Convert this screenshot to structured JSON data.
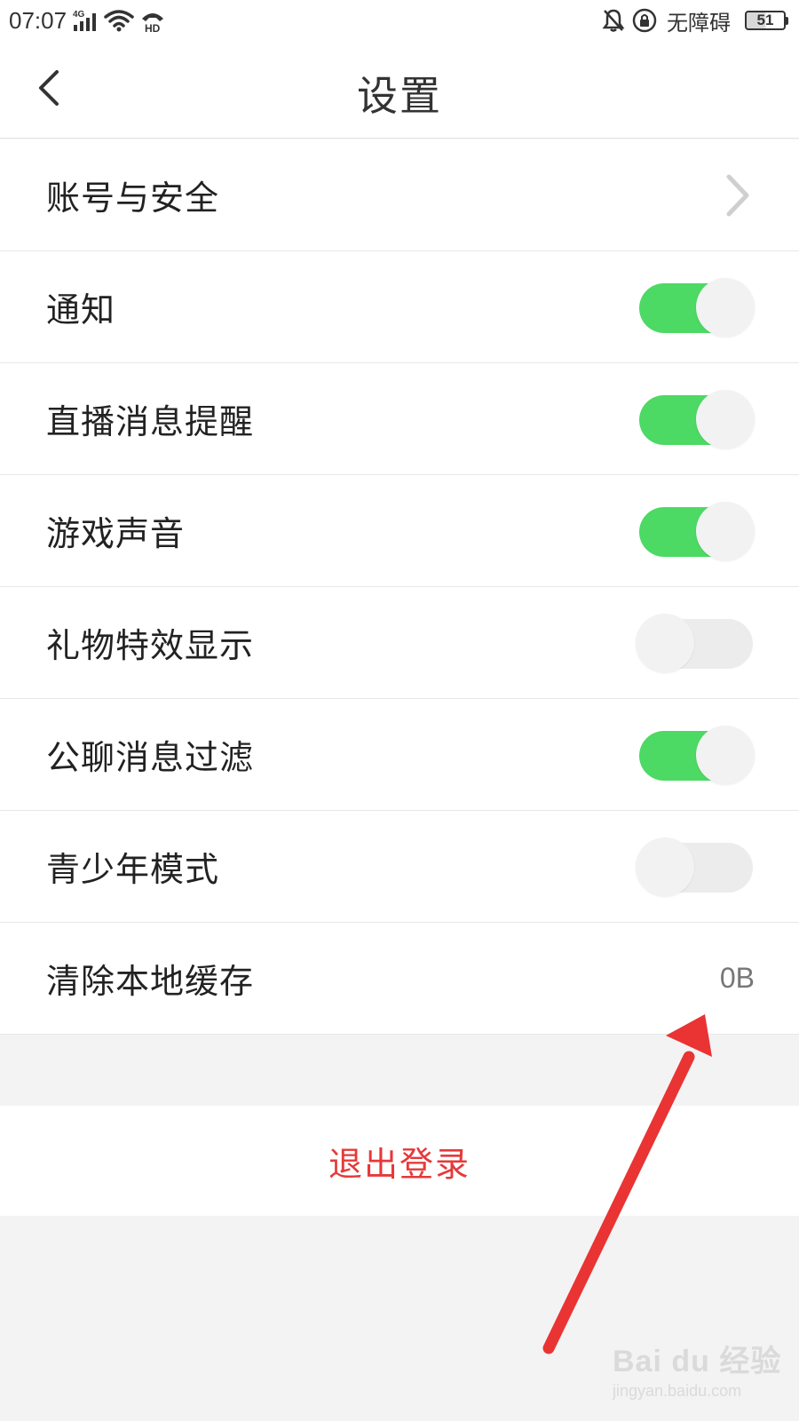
{
  "status_bar": {
    "time": "07:07",
    "network_label": "4G",
    "hd_label": "HD",
    "accessibility_label": "无障碍",
    "battery_level": "51"
  },
  "header": {
    "title": "设置",
    "back_icon": "chevron-left-icon"
  },
  "settings": [
    {
      "label": "账号与安全",
      "control": "chevron",
      "icon": "chevron-right-icon"
    },
    {
      "label": "通知",
      "control": "toggle",
      "on": true
    },
    {
      "label": "直播消息提醒",
      "control": "toggle",
      "on": true
    },
    {
      "label": "游戏声音",
      "control": "toggle",
      "on": true
    },
    {
      "label": "礼物特效显示",
      "control": "toggle",
      "on": false
    },
    {
      "label": "公聊消息过滤",
      "control": "toggle",
      "on": true
    },
    {
      "label": "青少年模式",
      "control": "toggle",
      "on": false
    },
    {
      "label": "清除本地缓存",
      "control": "value",
      "value": "0B"
    }
  ],
  "logout": {
    "label": "退出登录"
  },
  "colors": {
    "toggle_on": "#4cd964",
    "toggle_off": "#ececec",
    "logout_red": "#e5393a",
    "annotation_red": "#ea3333"
  },
  "watermark": {
    "logo": "Bai du 经验",
    "sub": "jingyan.baidu.com"
  }
}
